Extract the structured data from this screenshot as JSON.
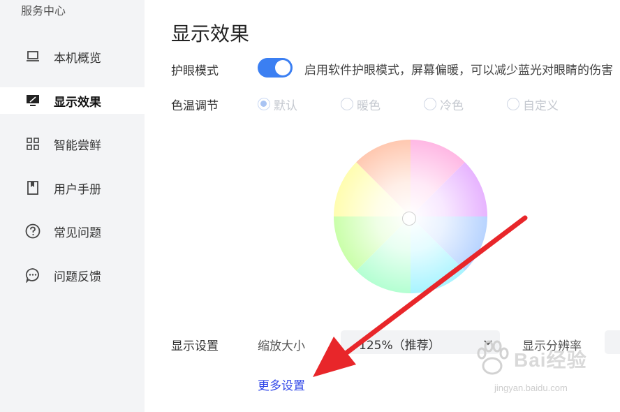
{
  "sidebar": {
    "title": "服务中心",
    "items": [
      {
        "label": "本机概览",
        "icon": "laptop-icon"
      },
      {
        "label": "显示效果",
        "icon": "monitor-icon",
        "active": true
      },
      {
        "label": "智能尝鲜",
        "icon": "grid-icon"
      },
      {
        "label": "用户手册",
        "icon": "book-icon"
      },
      {
        "label": "常见问题",
        "icon": "question-icon"
      },
      {
        "label": "问题反馈",
        "icon": "chat-icon"
      }
    ]
  },
  "main": {
    "title": "显示效果",
    "eye_care": {
      "label": "护眼模式",
      "enabled": true,
      "description": "启用软件护眼模式，屏幕偏暖，可以减少蓝光对眼睛的伤害"
    },
    "color_temp": {
      "label": "色温调节",
      "options": [
        "默认",
        "暖色",
        "冷色",
        "自定义"
      ],
      "selected": "默认"
    },
    "display_settings": {
      "label": "显示设置",
      "scale_label": "缩放大小",
      "scale_value": "125%（推荐）",
      "resolution_label": "显示分辨率"
    },
    "more_settings_link": "更多设置"
  },
  "watermark": {
    "brand": "Bai经验",
    "url": "jingyan.baidu.com"
  },
  "colors": {
    "accent": "#3b7ff2",
    "link": "#2f46e8",
    "arrow": "#e8262a",
    "sidebar_bg": "#f3f4f6"
  }
}
